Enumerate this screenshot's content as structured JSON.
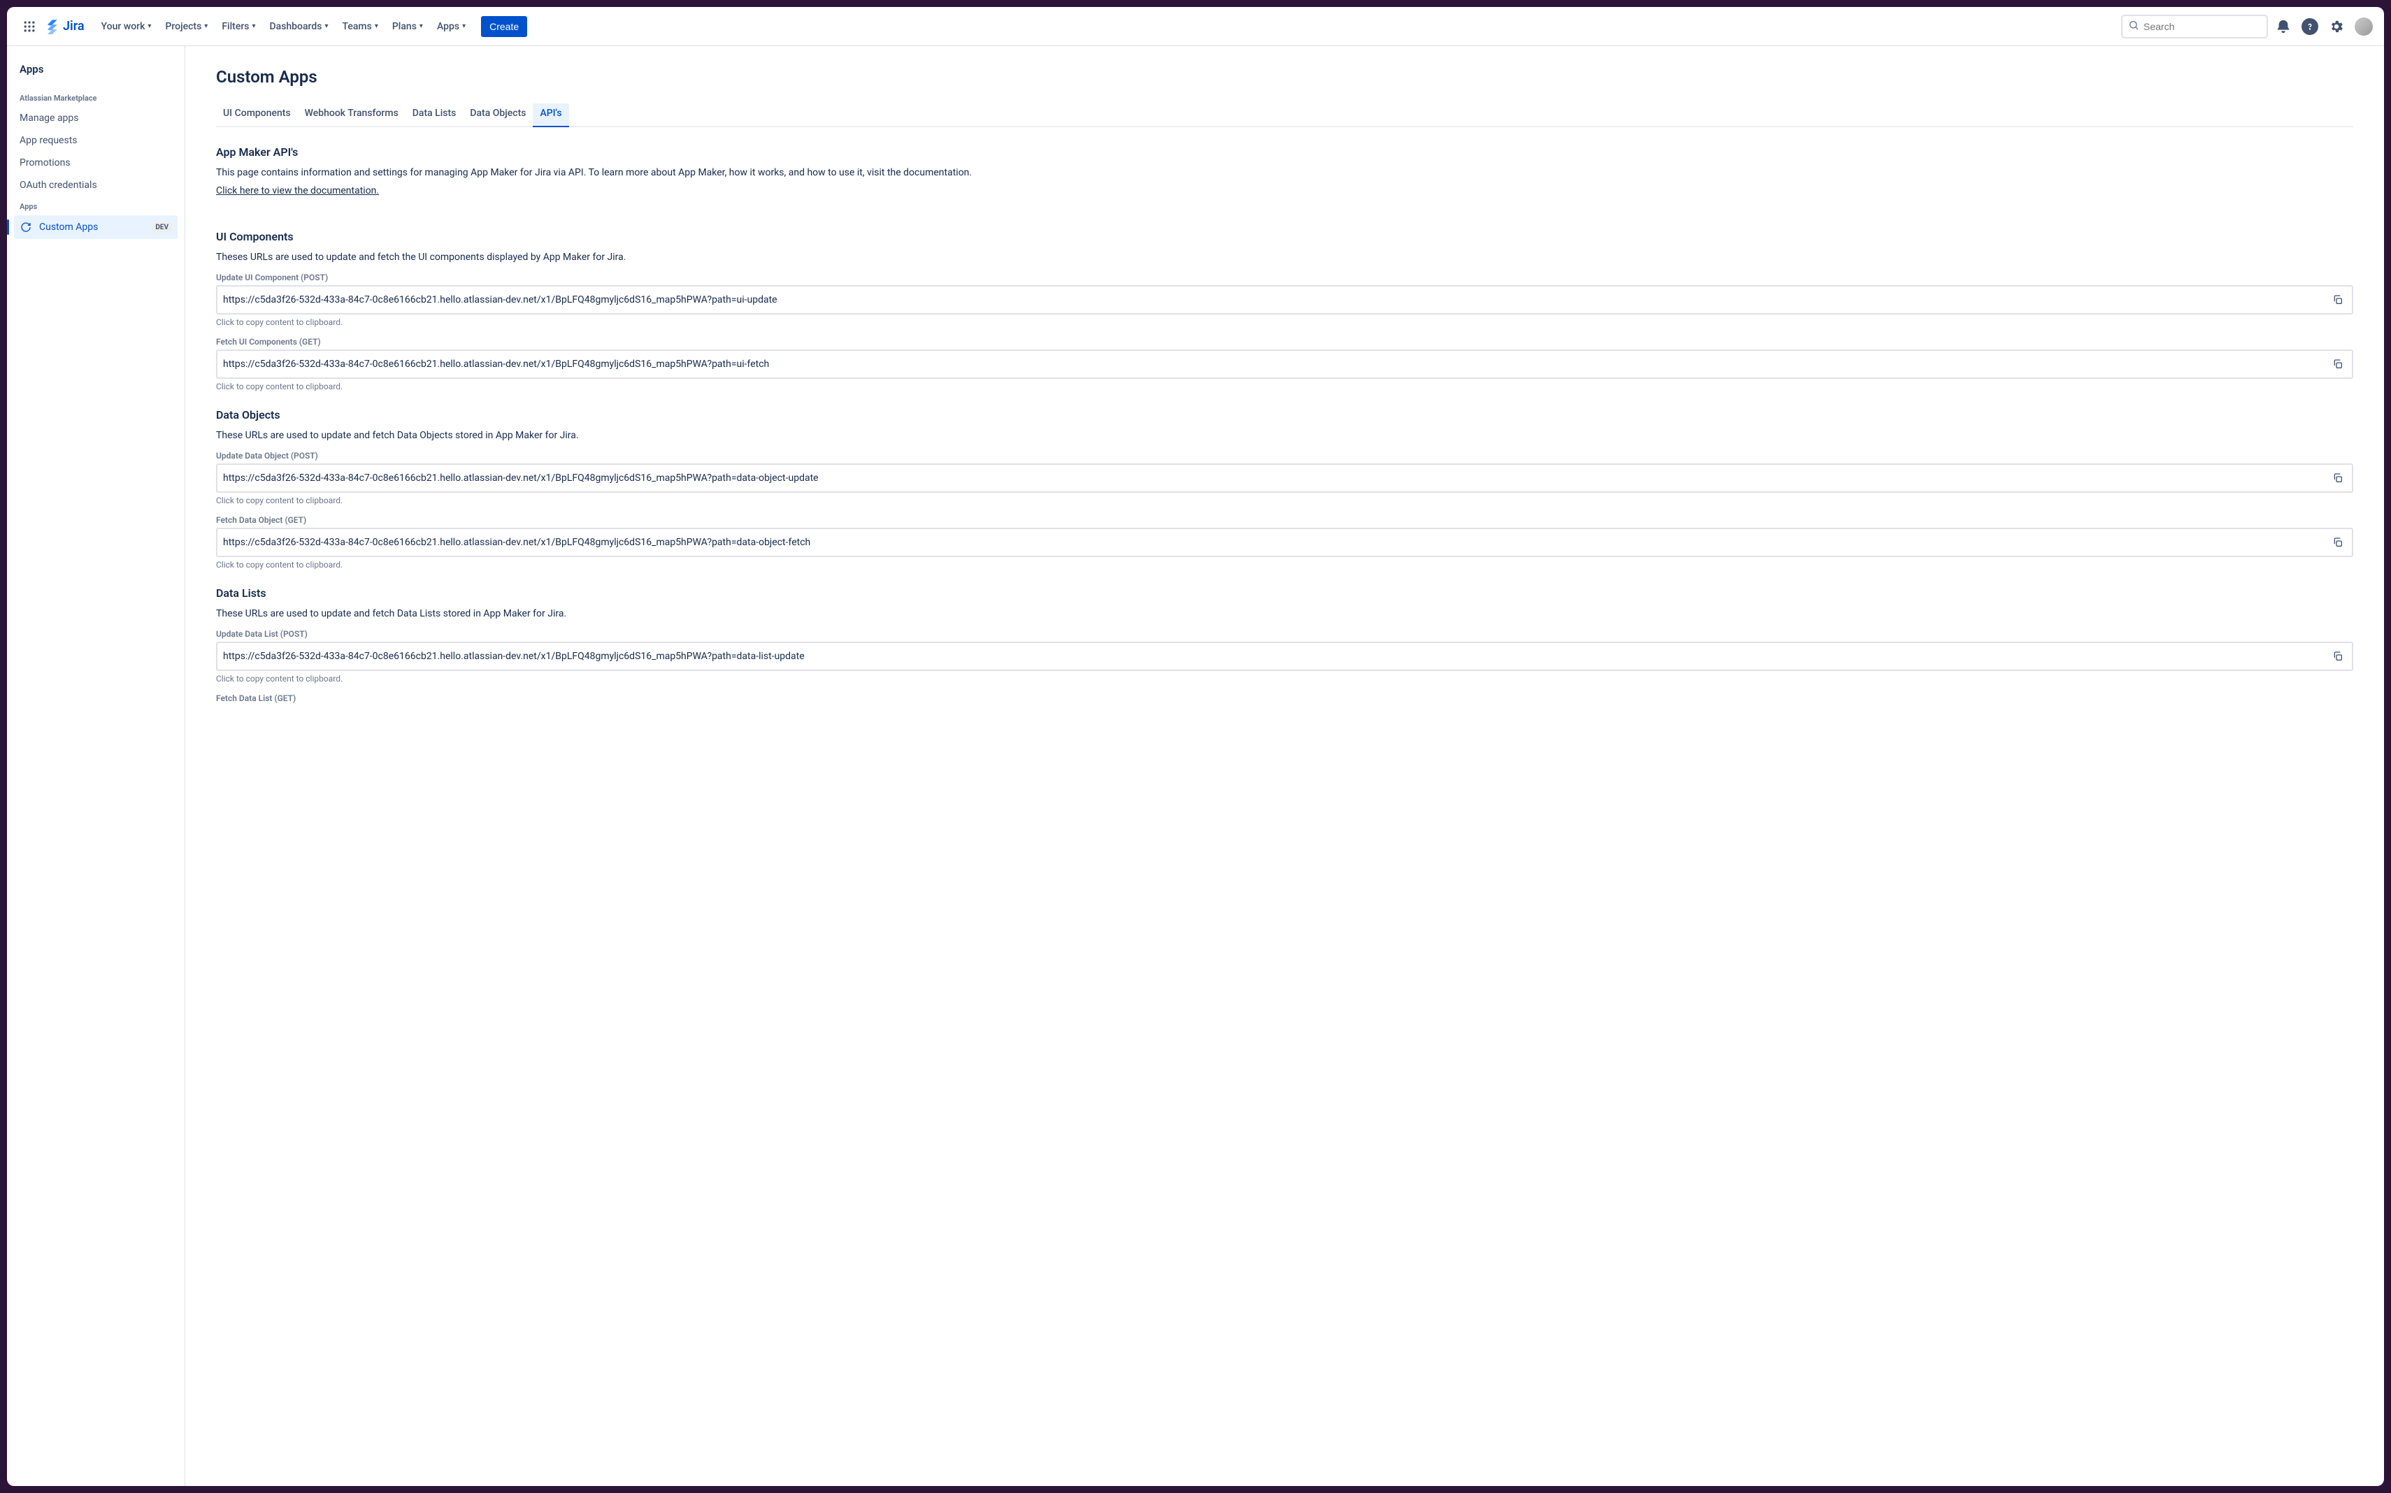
{
  "topnav": {
    "product": "Jira",
    "items": [
      "Your work",
      "Projects",
      "Filters",
      "Dashboards",
      "Teams",
      "Plans",
      "Apps"
    ],
    "create": "Create",
    "search_placeholder": "Search"
  },
  "sidebar": {
    "title": "Apps",
    "groups": [
      {
        "label": "Atlassian Marketplace",
        "items": [
          {
            "label": "Manage apps"
          },
          {
            "label": "App requests"
          },
          {
            "label": "Promotions"
          },
          {
            "label": "OAuth credentials"
          }
        ]
      },
      {
        "label": "Apps",
        "items": [
          {
            "label": "Custom Apps",
            "active": true,
            "badge": "DEV",
            "icon": "arrows-rotate-icon"
          }
        ]
      }
    ]
  },
  "page": {
    "title": "Custom Apps",
    "tabs": [
      "UI Components",
      "Webhook Transforms",
      "Data Lists",
      "Data Objects",
      "API's"
    ],
    "active_tab": "API's",
    "intro": {
      "heading": "App Maker API's",
      "text": "This page contains information and settings for managing App Maker for Jira via API. To learn more about App Maker, how it works, and how to use it, visit the documentation.",
      "doc_link": "Click here to view the documentation."
    },
    "sections": [
      {
        "heading": "UI Components",
        "desc": "Theses URLs are used to update and fetch the UI components displayed by App Maker for Jira.",
        "fields": [
          {
            "label": "Update UI Component (POST)",
            "url": "https://c5da3f26-532d-433a-84c7-0c8e6166cb21.hello.atlassian-dev.net/x1/BpLFQ48gmyljc6dS16_map5hPWA?path=ui-update",
            "helper": "Click to copy content to clipboard."
          },
          {
            "label": "Fetch UI Components (GET)",
            "url": "https://c5da3f26-532d-433a-84c7-0c8e6166cb21.hello.atlassian-dev.net/x1/BpLFQ48gmyljc6dS16_map5hPWA?path=ui-fetch",
            "helper": "Click to copy content to clipboard."
          }
        ]
      },
      {
        "heading": "Data Objects",
        "desc": "These URLs are used to update and fetch Data Objects stored in App Maker for Jira.",
        "fields": [
          {
            "label": "Update Data Object (POST)",
            "url": "https://c5da3f26-532d-433a-84c7-0c8e6166cb21.hello.atlassian-dev.net/x1/BpLFQ48gmyljc6dS16_map5hPWA?path=data-object-update",
            "helper": "Click to copy content to clipboard."
          },
          {
            "label": "Fetch Data Object (GET)",
            "url": "https://c5da3f26-532d-433a-84c7-0c8e6166cb21.hello.atlassian-dev.net/x1/BpLFQ48gmyljc6dS16_map5hPWA?path=data-object-fetch",
            "helper": "Click to copy content to clipboard."
          }
        ]
      },
      {
        "heading": "Data Lists",
        "desc": "These URLs are used to update and fetch Data Lists stored in App Maker for Jira.",
        "fields": [
          {
            "label": "Update Data List (POST)",
            "url": "https://c5da3f26-532d-433a-84c7-0c8e6166cb21.hello.atlassian-dev.net/x1/BpLFQ48gmyljc6dS16_map5hPWA?path=data-list-update",
            "helper": "Click to copy content to clipboard."
          },
          {
            "label": "Fetch Data List (GET)",
            "url": "",
            "helper": ""
          }
        ]
      }
    ]
  }
}
